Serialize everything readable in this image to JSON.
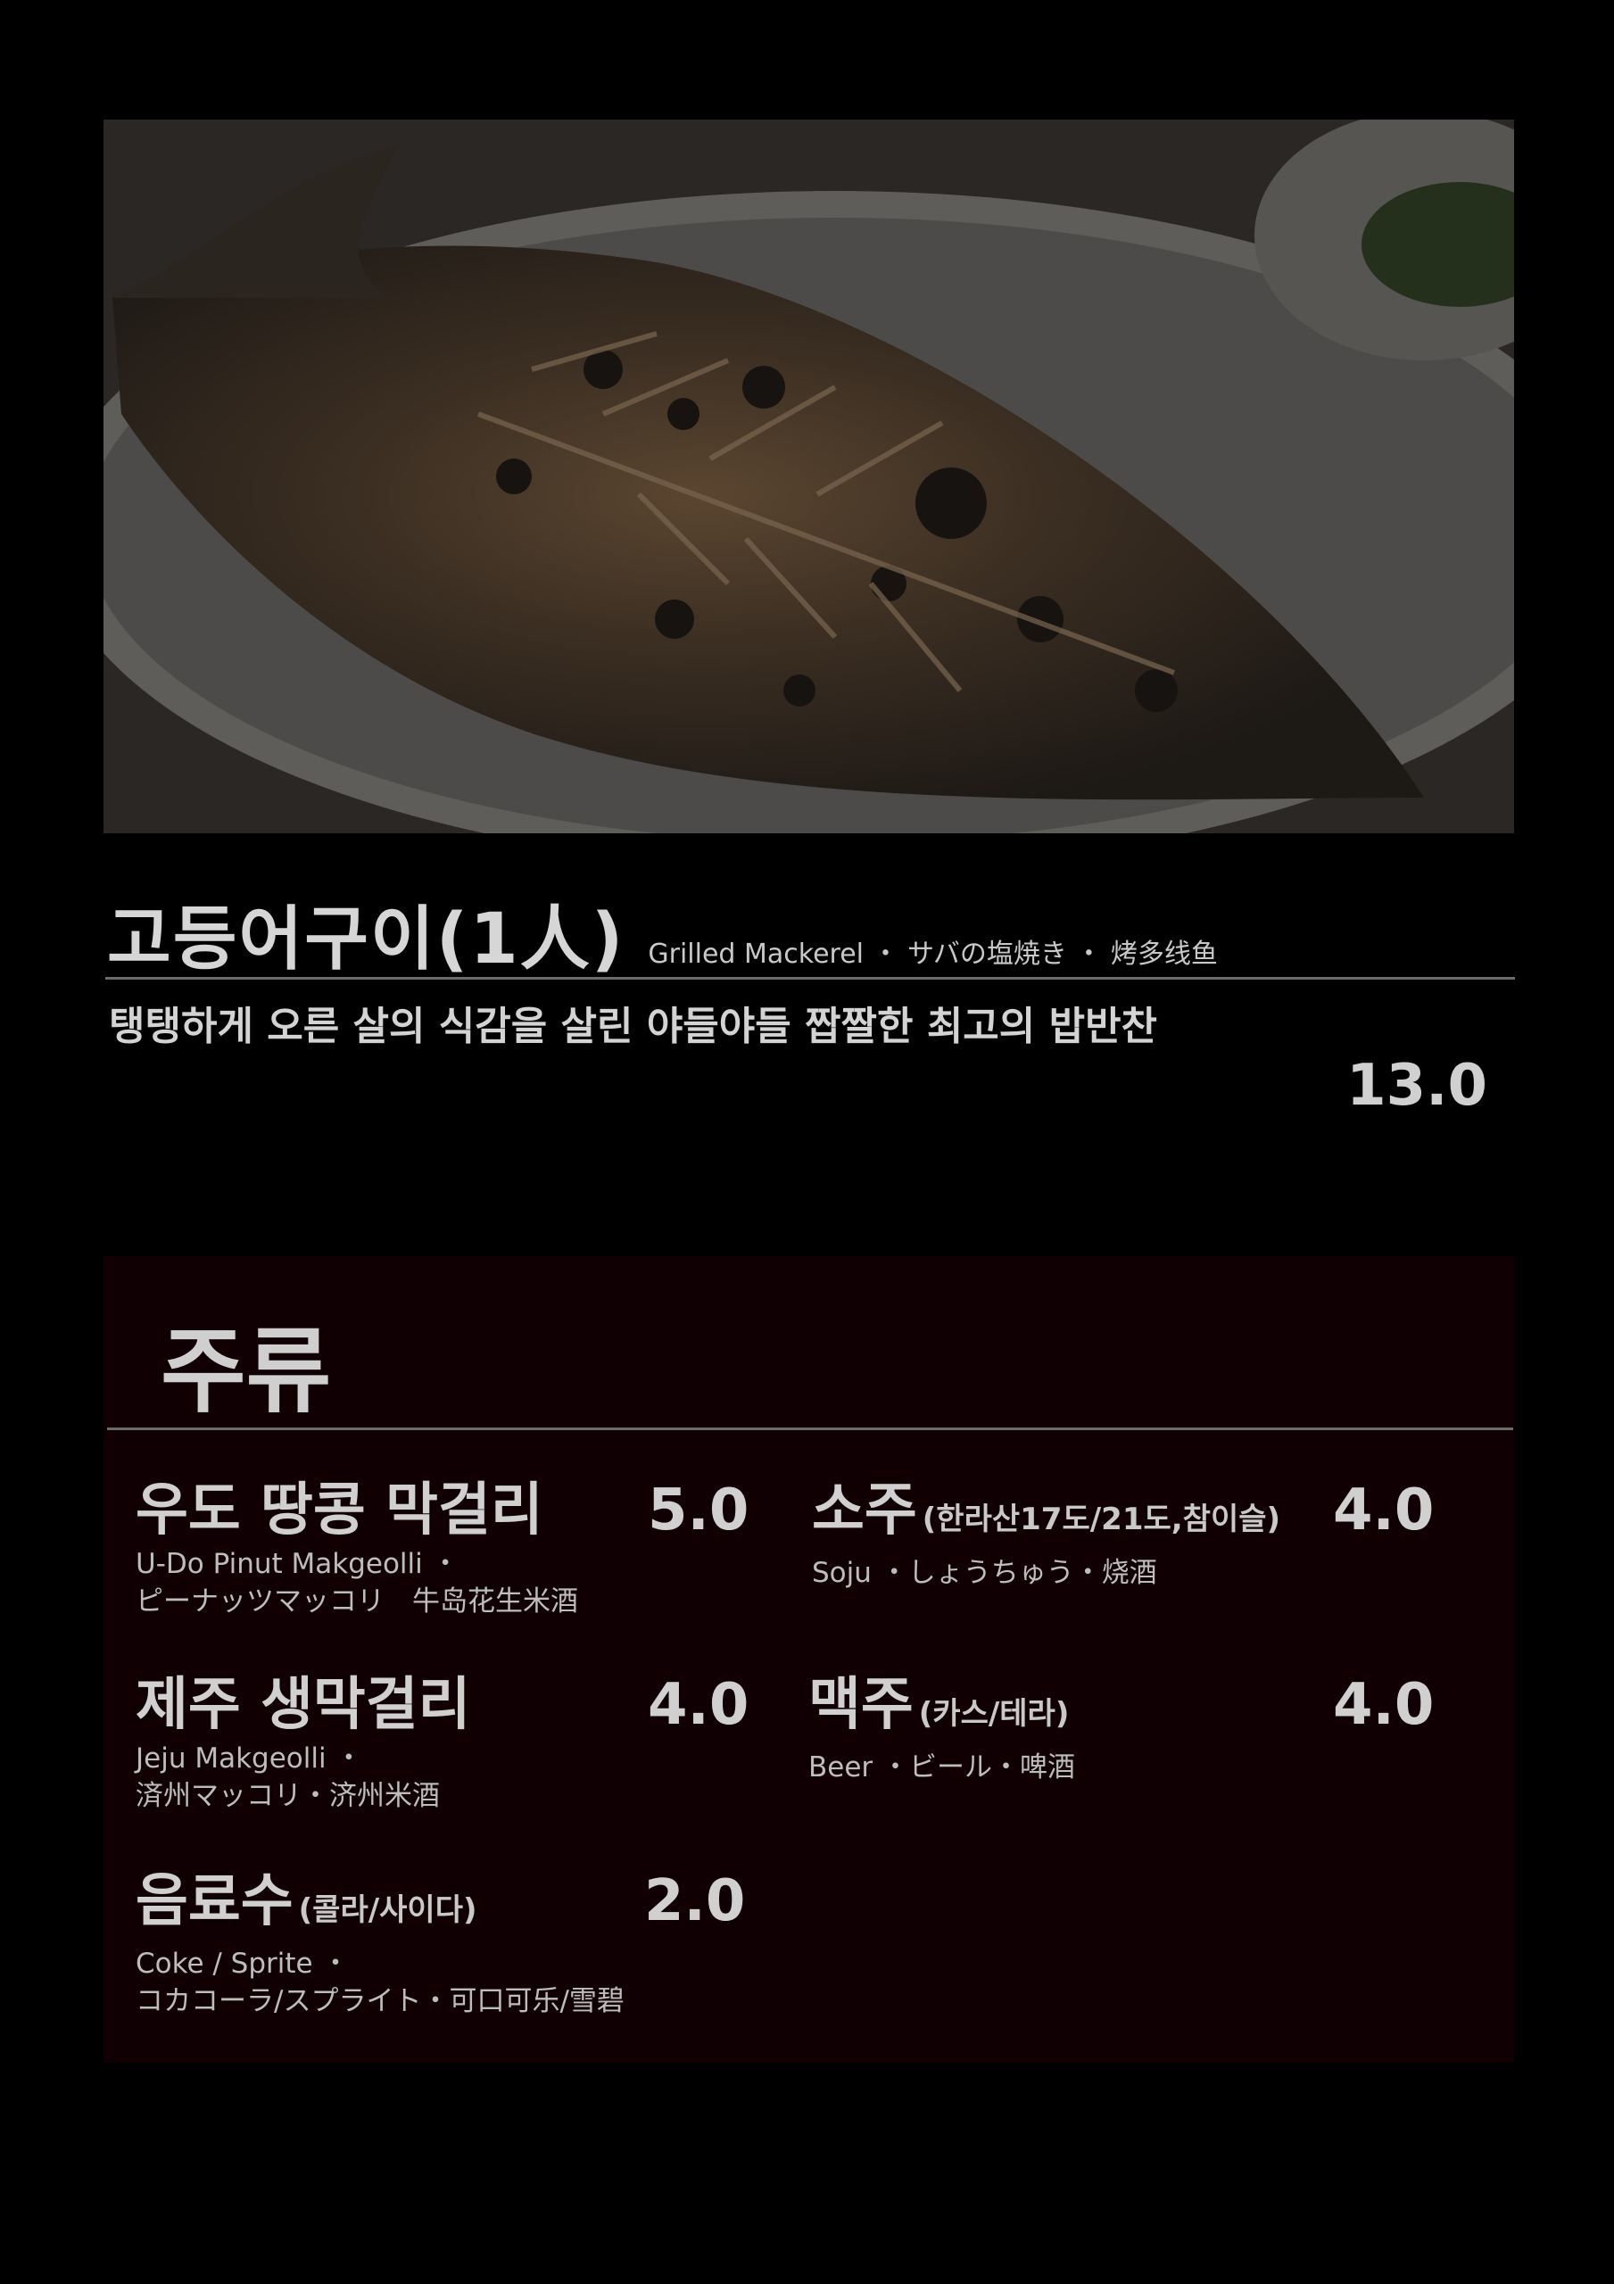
{
  "featured": {
    "photo": "grilled-mackerel-photo",
    "name": "고등어구이(1人)",
    "subtitle": "Grilled Mackerel ・ サバの塩焼き ・ 烤多线鱼",
    "description": "탱탱하게 오른 살의 식감을 살린 야들야들 짭짤한 최고의 밥반찬",
    "price": "13.0"
  },
  "drinks": {
    "title": "주류",
    "items": [
      {
        "name": "우도 땅콩 막걸리",
        "detail": "",
        "en": "U-Do Pinut Makgeolli ・",
        "jp": "ピーナッツマッコリ　牛岛花生米酒",
        "price": "5.0"
      },
      {
        "name": "소주",
        "detail": "(한라산17도/21도,참이슬)",
        "en": "Soju ・しょうちゅう・烧酒",
        "jp": "",
        "price": "4.0"
      },
      {
        "name": "제주 생막걸리",
        "detail": "",
        "en": "Jeju Makgeolli ・",
        "jp": "済州マッコリ・济州米酒",
        "price": "4.0"
      },
      {
        "name": "맥주",
        "detail": "(카스/테라)",
        "en": "Beer ・ビール・啤酒",
        "jp": "",
        "price": "4.0"
      },
      {
        "name": "음료수",
        "detail": "(콜라/사이다)",
        "en": "Coke / Sprite ・",
        "jp": "コカコーラ/スプライト・可口可乐/雪碧",
        "price": "2.0"
      }
    ]
  }
}
